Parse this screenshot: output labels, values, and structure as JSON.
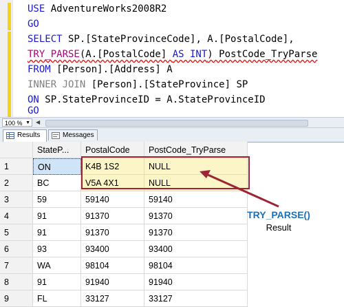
{
  "editor": {
    "lines": [
      {
        "kw": "USE",
        "rest": " AdventureWorks2008R2"
      },
      {
        "kw": "GO"
      },
      {
        "kw": "SELECT",
        "rest": " SP.[StateProvinceCode], A.[PostalCode],"
      },
      {
        "fn": "TRY_PARSE",
        "p1": "(A.[PostalCode] ",
        "kw": "AS INT",
        "p2": ") PostCode_TryParse"
      },
      {
        "kw": "FROM",
        "rest": " [Person].[Address] A"
      },
      {
        "gray": "INNER JOIN",
        "rest": " [Person].[StateProvince] SP"
      },
      {
        "kw": "ON",
        "rest": " SP.StateProvinceID = A.StateProvinceID"
      },
      {
        "kw": "GO"
      }
    ]
  },
  "zoom": {
    "value": "100 %"
  },
  "tabs": {
    "results": "Results",
    "messages": "Messages"
  },
  "grid": {
    "columns": [
      "StateP...",
      "PostalCode",
      "PostCode_TryParse"
    ],
    "rows": [
      {
        "num": "1",
        "state": "ON",
        "postal": "K4B 1S2",
        "try": "NULL"
      },
      {
        "num": "2",
        "state": "BC",
        "postal": "V5A 4X1",
        "try": "NULL"
      },
      {
        "num": "3",
        "state": "59",
        "postal": "59140",
        "try": "59140"
      },
      {
        "num": "4",
        "state": "91",
        "postal": "91370",
        "try": "91370"
      },
      {
        "num": "5",
        "state": "91",
        "postal": "91370",
        "try": "91370"
      },
      {
        "num": "6",
        "state": "93",
        "postal": "93400",
        "try": "93400"
      },
      {
        "num": "7",
        "state": "WA",
        "postal": "98104",
        "try": "98104"
      },
      {
        "num": "8",
        "state": "91",
        "postal": "91940",
        "try": "91940"
      },
      {
        "num": "9",
        "state": "FL",
        "postal": "33127",
        "try": "33127"
      }
    ]
  },
  "annotation": {
    "title": "TRY_PARSE()",
    "subtitle": "Result"
  },
  "colors": {
    "keyword": "#1818d6",
    "function": "#b0007f",
    "highlight_border": "#9c2434",
    "callout_text": "#1f6fb4"
  }
}
